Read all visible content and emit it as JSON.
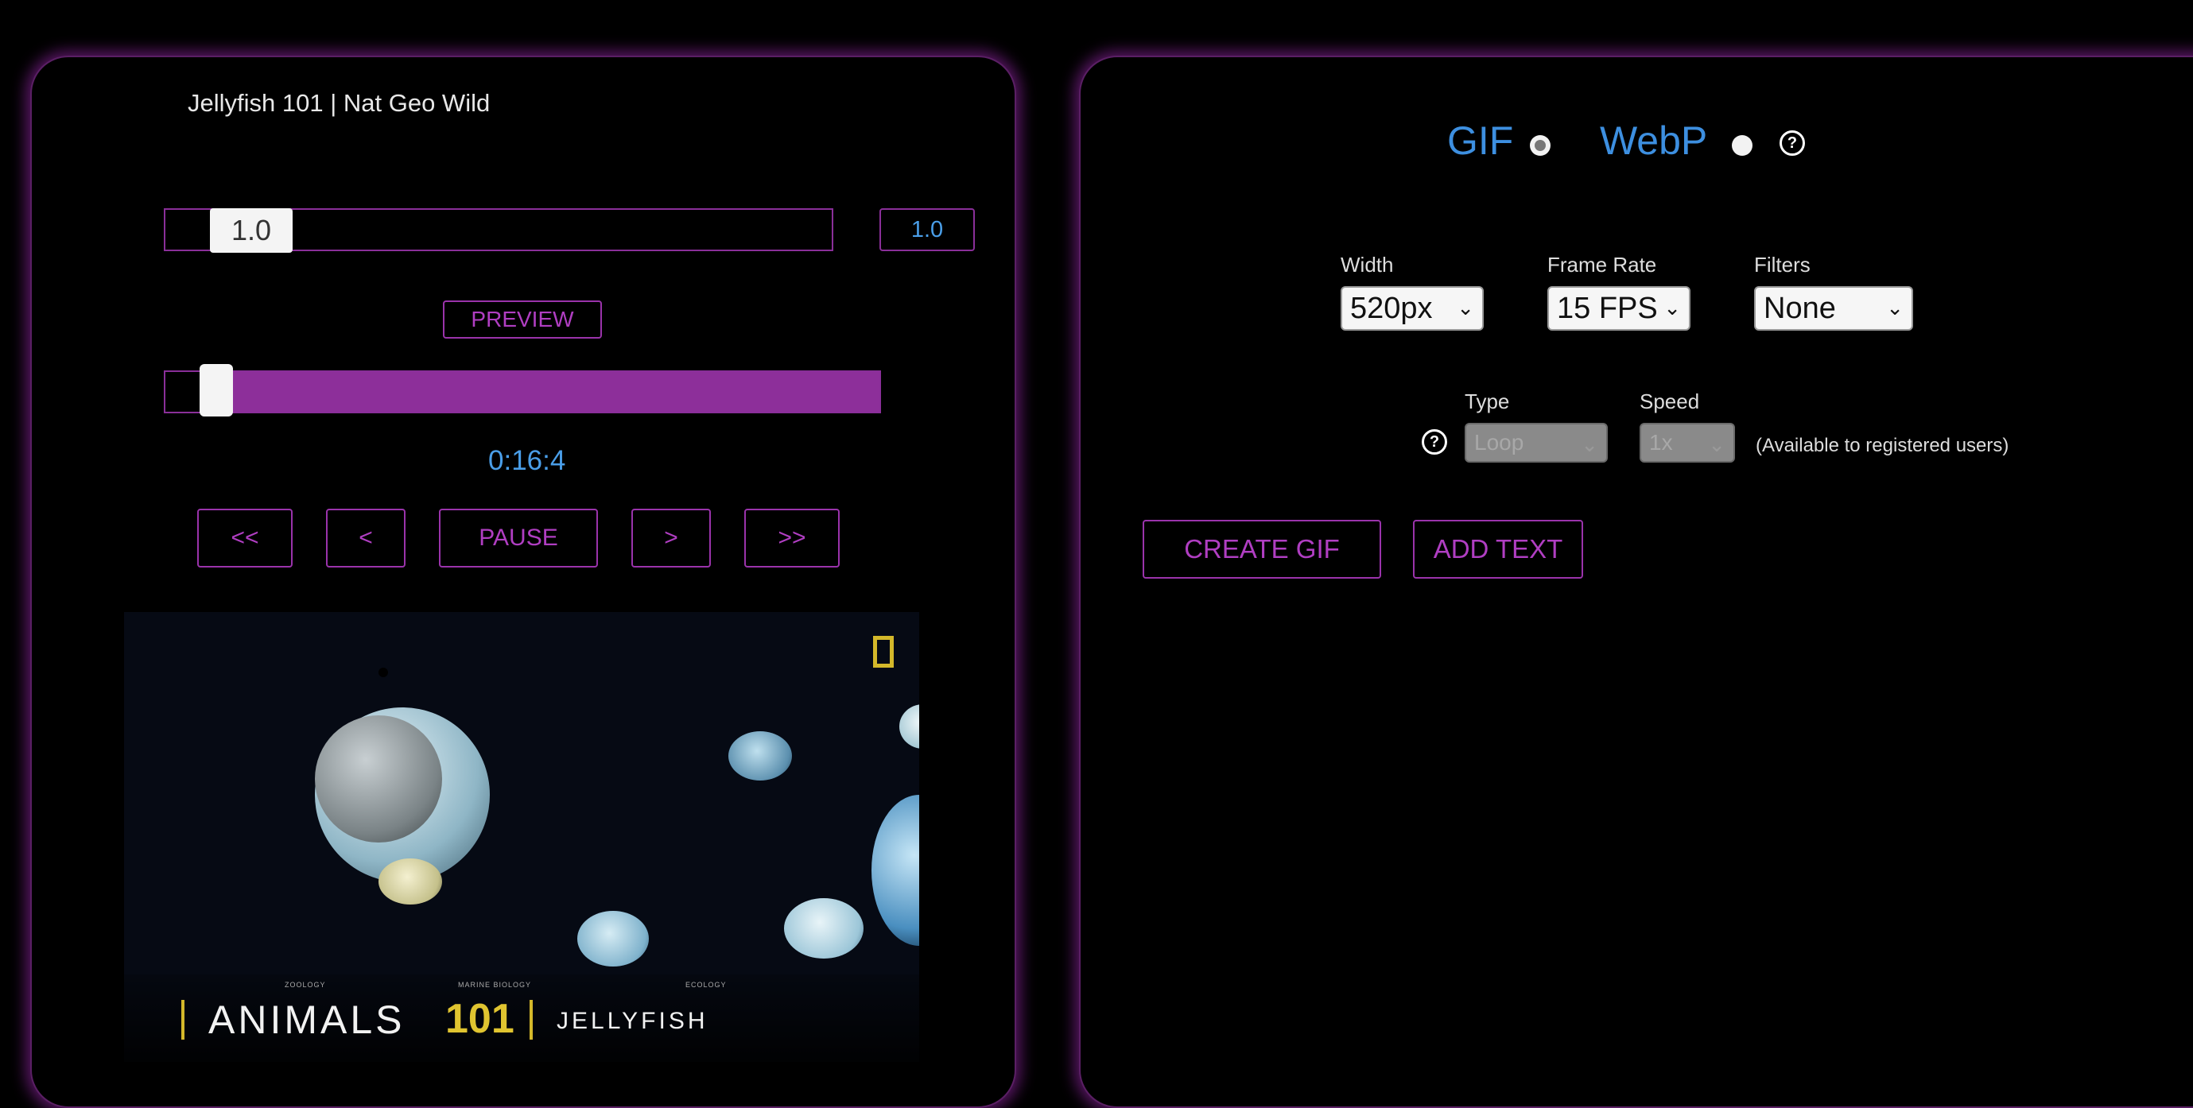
{
  "video": {
    "title": "Jellyfish 101 | Nat Geo Wild",
    "speed_slider_value": "1.0",
    "speed_input_value": "1.0",
    "preview_label": "PREVIEW",
    "time_display": "0:16:4",
    "timeline_position_fraction": 0.05,
    "nav": {
      "rewind": "<<",
      "back": "<",
      "pause": "PAUSE",
      "forward": ">",
      "fast_forward": ">>"
    },
    "caption": {
      "title": "ANIMALS",
      "number": "101",
      "subject": "JELLYFISH",
      "tags": [
        "ZOOLOGY",
        "MARINE BIOLOGY",
        "ECOLOGY"
      ]
    }
  },
  "format": {
    "gif_label": "GIF",
    "webp_label": "WebP",
    "selected": "GIF",
    "help_symbol": "?"
  },
  "settings": {
    "width_label": "Width",
    "width_value": "520px",
    "frame_rate_label": "Frame Rate",
    "frame_rate_value": "15 FPS",
    "filters_label": "Filters",
    "filters_value": "None",
    "type_label": "Type",
    "type_value": "Loop",
    "speed_label": "Speed",
    "speed_value": "1x",
    "availability_note": "(Available to registered users)",
    "chevron": "⌄"
  },
  "actions": {
    "create_gif": "CREATE GIF",
    "add_text": "ADD TEXT"
  },
  "colors": {
    "accent_purple": "#9a33ab",
    "accent_blue": "#3d8fe0",
    "background": "#000000"
  }
}
